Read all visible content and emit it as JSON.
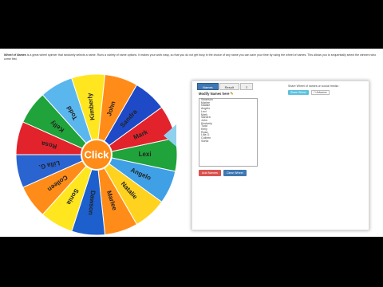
{
  "description": {
    "title": "Wheel of Names",
    "text": " is a great wheel spinner that randomly selects a name. Runs a variety of name options. It makes your work easy, so that you do not get busy in the choice of any name you can save your time by using the wheel of names. This allows you to sequentially select the winners who come first."
  },
  "wheel": {
    "center_label": "Click",
    "names": [
      "Lexi",
      "Angelo",
      "Natalie",
      "Marlee",
      "Dawson",
      "Sonia",
      "Colleen",
      "Lilla G.",
      "Rosa",
      "Kelly",
      "Todd",
      "Kimberly",
      "John",
      "Sandra",
      "Mark"
    ],
    "colors": [
      "#1fa33a",
      "#3fa0e6",
      "#ffd21f",
      "#ff8c18",
      "#1c5fcd",
      "#ffe61f",
      "#ff8c18",
      "#2a64d0",
      "#e3232b",
      "#1fa33a",
      "#5ab7ee",
      "#ffe61f",
      "#ff8c18",
      "#1e4ac7",
      "#e3232b"
    ],
    "center_color": "#ff8c18",
    "pointer_color": "#8fd0ee"
  },
  "panel": {
    "tabs": [
      "Names",
      "Result",
      "≡"
    ],
    "modify_label": "Modify Names here",
    "name_list": [
      "Swanson",
      "Marlee",
      "Natalie",
      "Angelo",
      "Lexi",
      "Mark",
      "Sandra",
      "John",
      "Kimberly",
      "Todd",
      "Kelly",
      "Rosa",
      "Lilla G.",
      "Colleen",
      "Sonia"
    ],
    "add_button": "Add Names",
    "clear_button": "Clear Wheel",
    "share_label": "Share Wheel of names on social media :",
    "share_button": "Share Wheel",
    "advanced_label": "☐ Advance"
  }
}
